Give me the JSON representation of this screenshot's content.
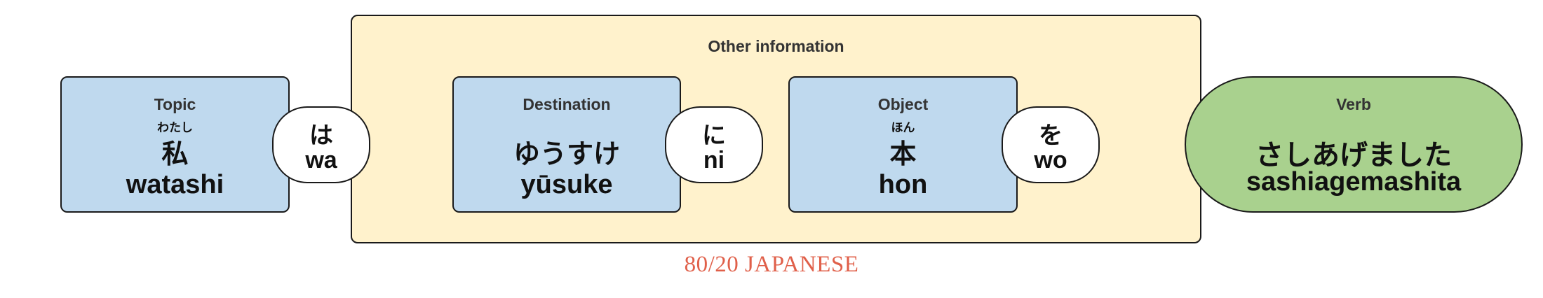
{
  "other_information": {
    "label": "Other information"
  },
  "topic": {
    "role": "Topic",
    "furigana": "わたし",
    "kana": "私",
    "romaji": "watashi"
  },
  "particle_wa": {
    "kana": "は",
    "romaji": "wa"
  },
  "destination": {
    "role": "Destination",
    "kana": "ゆうすけ",
    "romaji": "yūsuke"
  },
  "particle_ni": {
    "kana": "に",
    "romaji": "ni"
  },
  "object": {
    "role": "Object",
    "furigana": "ほん",
    "kana": "本",
    "romaji": "hon"
  },
  "particle_wo": {
    "kana": "を",
    "romaji": "wo"
  },
  "verb": {
    "role": "Verb",
    "kana": "さしあげました",
    "romaji": "sashiagemashita"
  },
  "brand": {
    "text": "80/20 JAPANESE",
    "color": "#e0604a"
  },
  "colors": {
    "card_blue": "#bfd9ee",
    "other_yellow": "#fff2cc",
    "verb_green": "#a9d18e"
  }
}
